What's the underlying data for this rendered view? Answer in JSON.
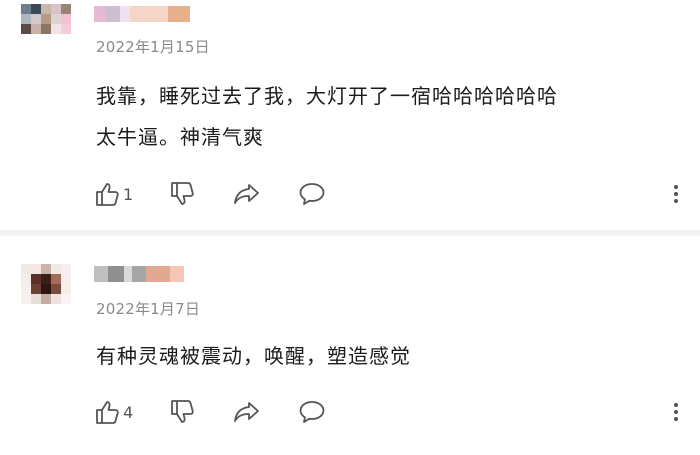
{
  "comments": [
    {
      "date": "2022年1月15日",
      "lines": [
        "我靠，睡死过去了我，大灯开了一宿哈哈哈哈哈哈",
        "太牛逼。神清气爽"
      ],
      "like_count": "1",
      "avatar_colors": [
        "#6d7f8f",
        "#3b4a5a",
        "#c9b7aa",
        "#d9c3c9",
        "#9a8478",
        "#aeb6c2",
        "#d1c9cc",
        "#b59a86",
        "#e0d3cf",
        "#f1c2cf",
        "#5b4b46",
        "#c7b3a8",
        "#8c7564",
        "#f0e4e6",
        "#f7cbd9"
      ],
      "name_colors": [
        "#e6b9d7",
        "#cdbfcf",
        "#efe2ee",
        "#f4d5c8",
        "#e6b08c"
      ]
    },
    {
      "date": "2022年1月7日",
      "lines": [
        "有种灵魂被震动，唤醒，塑造感觉"
      ],
      "like_count": "4",
      "avatar_colors": [
        "#efe9e6",
        "#f4e6e0",
        "#cbb3aa",
        "#f2e8e5",
        "#f5eeee",
        "#f4ece9",
        "#5a3028",
        "#3b1e17",
        "#a66d5d",
        "#f6efed",
        "#f5efed",
        "#6e3f33",
        "#2d1511",
        "#7b4b3e",
        "#f5efec",
        "#f6f0ef",
        "#e8ded9",
        "#c6aca3",
        "#eee2de",
        "#f8f3f2"
      ],
      "name_colors": [
        "#bfbfbf",
        "#8f8f8f",
        "#d9d9d9",
        "#a6a6a6",
        "#e2a892",
        "#f3c6b5"
      ]
    }
  ],
  "icons": {
    "like": "thumbs-up-icon",
    "dislike": "thumbs-down-icon",
    "share": "share-arrow-icon",
    "reply": "comment-bubble-icon",
    "more": "more-vertical-icon"
  }
}
